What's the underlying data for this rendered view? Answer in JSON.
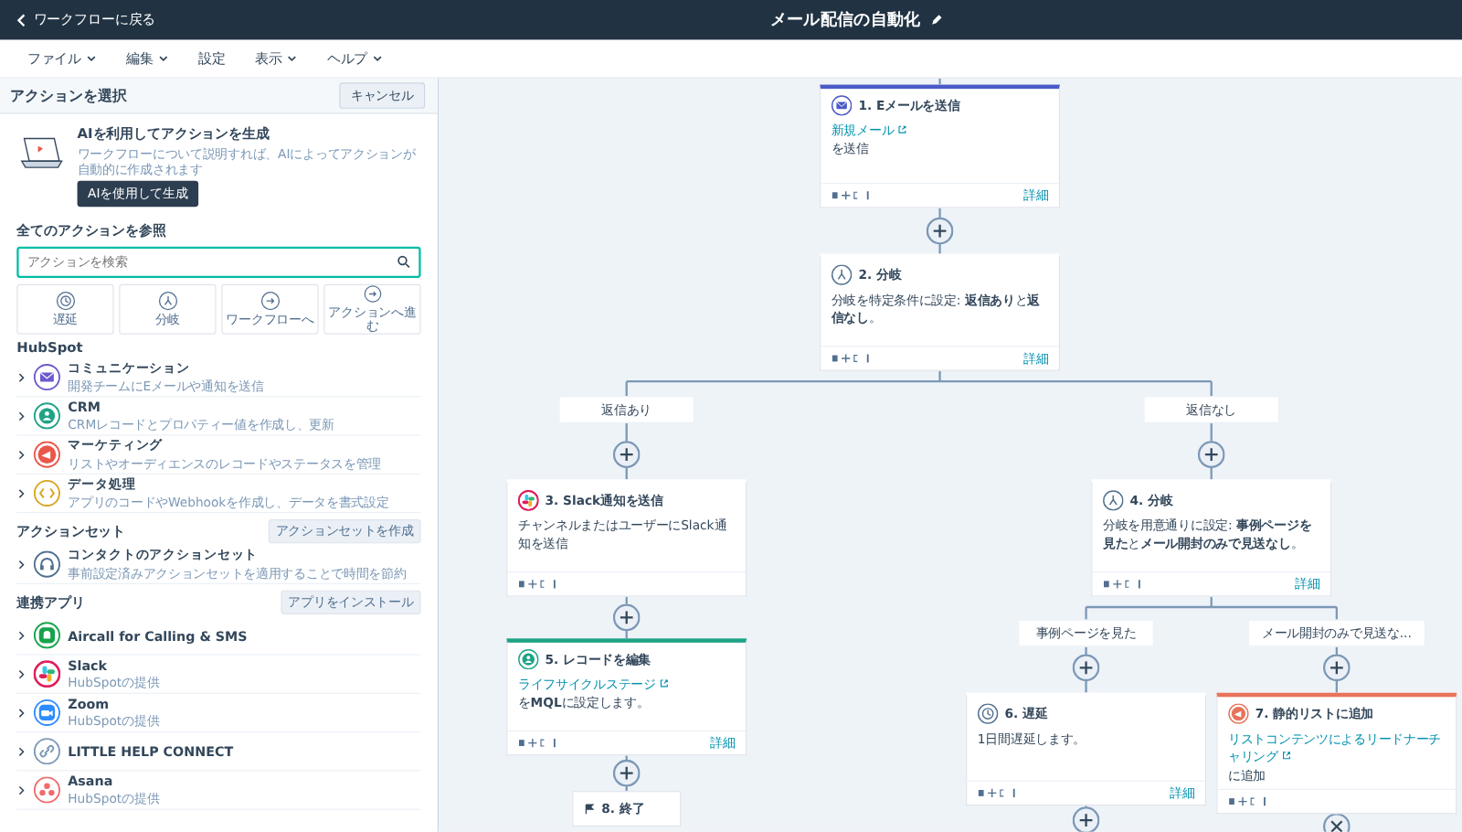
{
  "header": {
    "back_link": "ワークフローに戻る",
    "title": "メール配信の自動化"
  },
  "menu": [
    {
      "label": "ファイル",
      "dropdown": true
    },
    {
      "label": "編集",
      "dropdown": true
    },
    {
      "label": "設定",
      "dropdown": false
    },
    {
      "label": "表示",
      "dropdown": true
    },
    {
      "label": "ヘルプ",
      "dropdown": true
    }
  ],
  "panel": {
    "title": "アクションを選択",
    "cancel": "キャンセル",
    "ai": {
      "title": "AIを利用してアクションを生成",
      "description": "ワークフローについて説明すれば、AIによってアクションが自動的に作成されます",
      "button": "AIを使用して生成"
    },
    "browse_title": "全てのアクションを参照",
    "search": {
      "placeholder": "アクションを検索"
    },
    "quick_actions": [
      {
        "label": "遅延",
        "kind": "delay"
      },
      {
        "label": "分岐",
        "kind": "branch"
      },
      {
        "label": "ワークフローへ",
        "kind": "goto"
      },
      {
        "label": "アクションへ進む",
        "kind": "goto"
      }
    ],
    "sections": [
      {
        "title": "HubSpot",
        "items": [
          {
            "name": "コミュニケーション",
            "description": "開発チームにEメールや通知を送信",
            "kind": "communication",
            "color": "#6a5acd"
          },
          {
            "name": "CRM",
            "description": "CRMレコードとプロパティー値を作成し、更新",
            "kind": "crm",
            "color": "#1fa386"
          },
          {
            "name": "マーケティング",
            "description": "リストやオーディエンスのレコードやステータスを管理",
            "kind": "marketing",
            "color": "#e8574a"
          },
          {
            "name": "データ処理",
            "description": "アプリのコードやWebhookを作成し、データを書式設定",
            "kind": "data",
            "color": "#d9a520"
          }
        ]
      },
      {
        "title": "アクションセット",
        "button": "アクションセットを作成",
        "items": [
          {
            "name": "コンタクトのアクションセット",
            "description": "事前設定済みアクションセットを適用することで時間を節約",
            "kind": "actionset",
            "color": "#516f90"
          }
        ]
      },
      {
        "title": "連携アプリ",
        "button": "アプリをインストール",
        "items": [
          {
            "name": "Aircall for Calling & SMS",
            "kind": "calling",
            "color": "#16a34a"
          },
          {
            "name": "Slack",
            "description": "HubSpotの提供",
            "kind": "chat",
            "color": "#e01e5a"
          },
          {
            "name": "Zoom",
            "description": "HubSpotの提供",
            "kind": "video",
            "color": "#2d8cff"
          },
          {
            "name": "LITTLE HELP CONNECT",
            "kind": "connector",
            "color": "#7c98b6"
          },
          {
            "name": "Asana",
            "description": "HubSpotの提供",
            "kind": "tasks",
            "color": "#f06a6a"
          }
        ]
      }
    ]
  },
  "nodes": [
    {
      "kind": "email",
      "title": "1. Eメールを送信",
      "color": "#4a5ac8",
      "accent": true,
      "body": [
        {
          "text": "新規メール",
          "link": true
        },
        {
          "text": "を送信",
          "link": false
        }
      ],
      "details": "詳細"
    },
    {
      "kind": "branch",
      "title": "2. 分岐",
      "color": "#516f90",
      "accent": false,
      "body": [
        {
          "text": "分岐を特定条件に設定: **返信あり**と**返信なし**。",
          "link": false
        }
      ],
      "details": "詳細"
    },
    {
      "kind": "chat",
      "title": "3. Slack通知を送信",
      "color": "#e01e5a",
      "accent": false,
      "body": [
        {
          "text": "チャンネルまたはユーザーにSlack通知を送信",
          "link": false
        }
      ]
    },
    {
      "kind": "branch",
      "title": "4. 分岐",
      "color": "#516f90",
      "accent": false,
      "body": [
        {
          "text": "分岐を用意通りに設定: **事例ページを見た**と**メール開封のみで見送なし**。",
          "link": false
        }
      ],
      "details": "詳細"
    },
    {
      "kind": "record",
      "title": "5. レコードを編集",
      "color": "#1fa386",
      "accent": true,
      "body": [
        {
          "text": "ライフサイクルステージ",
          "link": true
        },
        {
          "text": "を**MQL**に設定します。",
          "link": false
        }
      ],
      "details": "詳細"
    },
    {
      "kind": "delay",
      "title": "6. 遅延",
      "color": "#516f90",
      "accent": false,
      "body": [
        {
          "text": "1日間遅延します。",
          "link": false
        }
      ],
      "details": "詳細"
    },
    {
      "kind": "list",
      "title": "7. 静的リストに追加",
      "color": "#e8735a",
      "accent": true,
      "body": [
        {
          "text": "リストコンテンツによるリードナーチャリング",
          "link": true
        },
        {
          "text": "に追加",
          "link": false
        }
      ]
    },
    {
      "kind": "end",
      "title": "8. 終了"
    }
  ],
  "branch_labels": [
    {
      "text": "返信あり"
    },
    {
      "text": "返信なし"
    },
    {
      "text": "事例ページを見た"
    },
    {
      "text": "メール開封のみで見送な..."
    }
  ]
}
